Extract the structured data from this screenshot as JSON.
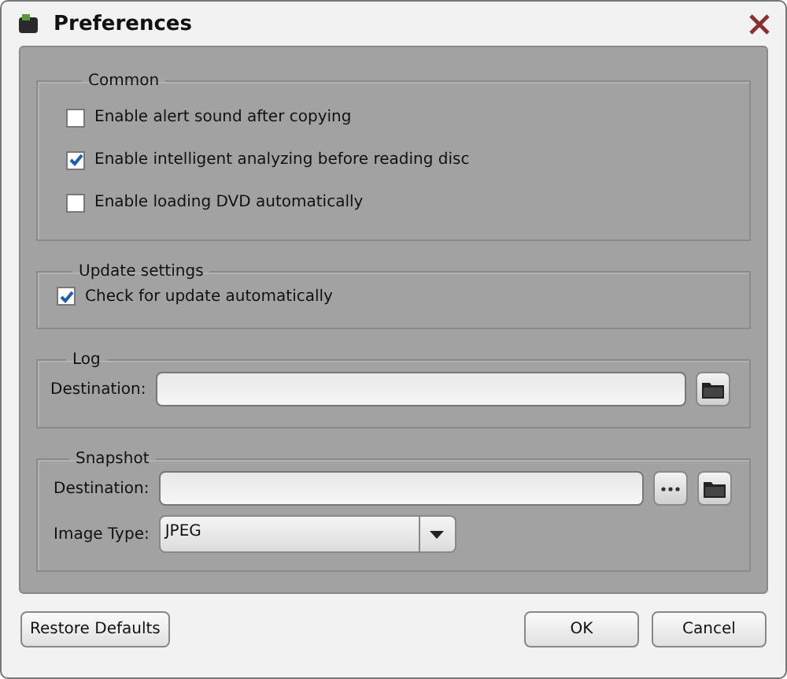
{
  "window": {
    "title": "Preferences"
  },
  "common": {
    "title": "Common",
    "options": [
      {
        "label": "Enable alert sound after copying",
        "checked": false
      },
      {
        "label": "Enable intelligent analyzing before reading disc",
        "checked": true
      },
      {
        "label": "Enable loading DVD automatically",
        "checked": false
      }
    ]
  },
  "update": {
    "title": "Update settings",
    "options": [
      {
        "label": "Check for update automatically",
        "checked": true
      }
    ]
  },
  "log": {
    "title": "Log",
    "destination_label": "Destination:"
  },
  "snapshot": {
    "title": "Snapshot",
    "destination_label": "Destination:",
    "image_type_label": "Image Type:",
    "image_type": "JPEG"
  },
  "buttons": {
    "restore": "Restore Defaults",
    "ok": "OK",
    "cancel": "Cancel"
  }
}
